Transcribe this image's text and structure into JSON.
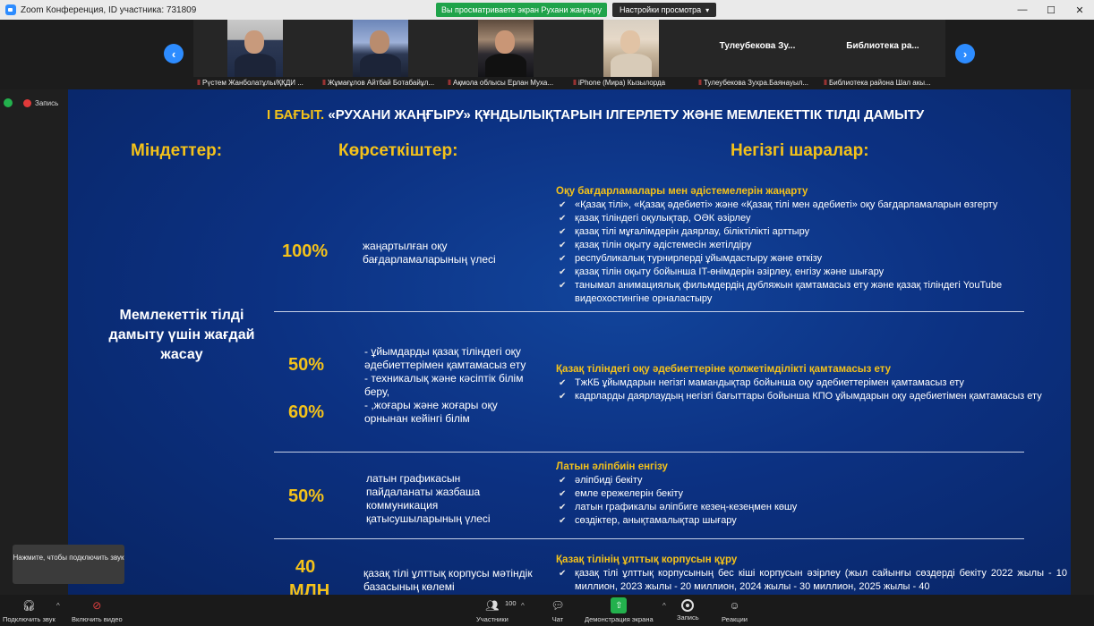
{
  "window": {
    "title": "Zoom Конференция, ID участника: 731809",
    "share_banner": "Вы просматриваете экран Рухани жаңғыру",
    "view_options": "Настройки просмотра",
    "minimize": "—",
    "maximize": "☐",
    "close": "✕"
  },
  "participants": [
    {
      "name": "Рүстем Жанболатұлы/ҚҚДИ ...",
      "camera": true
    },
    {
      "name": "Жұмағұлов Айтбай Ботабайұл...",
      "camera": true
    },
    {
      "name": "Ақмола облысы Ерлан Муха...",
      "camera": true
    },
    {
      "name": "iPhone (Мира) Кызылорда",
      "camera": true
    },
    {
      "name": "Тулеубекова Зухра.Баянауыл...",
      "tile_name": "Тулеубекова Зу...",
      "camera": false
    },
    {
      "name": "Библиотека района Шал акы...",
      "tile_name": "Библиотека ра...",
      "camera": false
    }
  ],
  "nav": {
    "prev": "‹",
    "next": "›"
  },
  "record": {
    "label": "Запись"
  },
  "slide": {
    "heading_prefix": "І БАҒЫТ.",
    "heading_rest": " «РУХАНИ ЖАҢҒЫРУ» ҚҰНДЫЛЫҚТАРЫН ІЛГЕРЛЕТУ ЖӘНЕ МЕМЛЕКЕТТІК ТІЛДІ ДАМЫТУ",
    "col_tasks": "Міндеттер:",
    "col_indicators": "Көрсеткіштер:",
    "col_measures": "Негізгі шаралар:",
    "task": "Мемлекеттік тілді дамыту үшін жағдай жасау",
    "rows": [
      {
        "pct": "100%",
        "indicator": "жаңартылған оқу бағдарламаларының үлесі",
        "section": "Оқу бағдарламалары мен әдістемелерін жаңарту",
        "items": [
          "«Қазақ тілі», «Қазақ әдебиеті» және «Қазақ тілі мен әдебиеті» оқу бағдарламаларын өзгерту",
          "қазақ тіліндегі оқулықтар, ОӘК әзірлеу",
          "қазақ тілі мұғалімдерін даярлау, біліктілікті арттыру",
          "қазақ тілін оқыту әдістемесін жетілдіру",
          "республикалық турнирлерді ұйымдастыру және өткізу",
          "қазақ тілін оқыту бойынша IT-өнімдерін әзірлеу, енгізу және шығару",
          "танымал анимациялық фильмдердің дубляжын қамтамасыз ету және қазақ тіліндегі YouTube видеохостингіне орналастыру"
        ]
      },
      {
        "pct": "50%",
        "pct2": "60%",
        "indicator": "- ұйымдарды қазақ тіліндегі оқу әдебиеттерімен қамтамасыз ету\n- техникалық және кәсіптік білім беру,\n- ,жоғары және жоғары оқу орнынан кейінгі білім",
        "section": "Қазақ тіліндегі оқу әдебиеттеріне қолжетімділікті қамтамасыз ету",
        "items": [
          "ТжКБ ұйымдарын негізгі мамандықтар бойынша оқу әдебиеттерімен қамтамасыз ету",
          "кадрларды даярлаудың негізгі бағыттары бойынша КПО ұйымдарын оқу әдебиетімен қамтамасыз ету"
        ]
      },
      {
        "pct": "50%",
        "indicator": "латын графикасын пайдаланаты жазбаша коммуникация қатысушыларының үлесі",
        "section": "Латын әліпбиін енгізу",
        "items": [
          "әліпбиді бекіту",
          "емле ережелерін бекіту",
          "латын графикалы әліпбиге кезең-кезеңмен көшу",
          "сөздіктер, анықтамалықтар шығару"
        ]
      },
      {
        "pct": "40",
        "pct2": "МЛН",
        "indicator": "қазақ тілі ұлттық корпусы мәтіндік базасының көлемі",
        "section": "Қазақ тілінің ұлттық корпусын құру",
        "items": [
          "қазақ тілі ұлттық корпусының бес кіші корпусын әзірлеу (жыл сайынғы сөздерді бекіту 2022 жылы - 10 миллион, 2023 жылы - 20 миллион, 2024 жылы - 30 миллион, 2025 жылы - 40"
        ]
      }
    ]
  },
  "tooltip": "Нажмите, чтобы подключить звук",
  "toolbar": {
    "audio": "Подключить звук",
    "video": "Включить видео",
    "participants": "Участники",
    "participants_count": "100",
    "chat": "Чат",
    "share": "Демонстрация экрана",
    "record": "Запись",
    "reactions": "Реакции"
  },
  "colors": {
    "accent": "#2d8cff",
    "share_green": "#1fa34a",
    "slide_bg": "#0c3182",
    "slide_yellow": "#f4c21a"
  }
}
